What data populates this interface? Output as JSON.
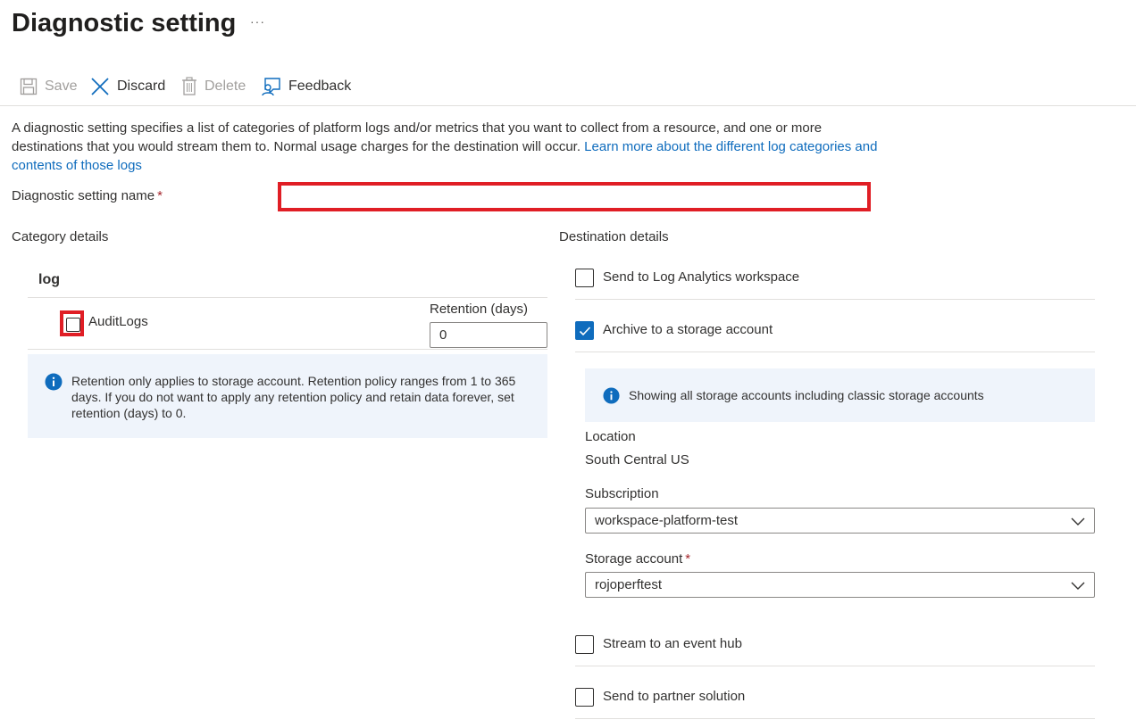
{
  "header": {
    "title": "Diagnostic setting",
    "more": "···"
  },
  "toolbar": {
    "save": "Save",
    "discard": "Discard",
    "delete": "Delete",
    "feedback": "Feedback"
  },
  "description": {
    "text": "A diagnostic setting specifies a list of categories of platform logs and/or metrics that you want to collect from a resource, and one or more destinations that you would stream them to. Normal usage charges for the destination will occur. ",
    "link": "Learn more about the different log categories and contents of those logs"
  },
  "name_field": {
    "label": "Diagnostic setting name",
    "required": "*",
    "value": ""
  },
  "category": {
    "title": "Category details",
    "group": "log",
    "items": [
      {
        "label": "AuditLogs",
        "checked": false
      }
    ],
    "retention_label": "Retention (days)",
    "retention_value": "0",
    "info": "Retention only applies to storage account. Retention policy ranges from 1 to 365 days. If you do not want to apply any retention policy and retain data forever, set retention (days) to 0."
  },
  "destination": {
    "title": "Destination details",
    "log_analytics": {
      "label": "Send to Log Analytics workspace",
      "checked": false
    },
    "storage": {
      "label": "Archive to a storage account",
      "checked": true
    },
    "storage_info": "Showing all storage accounts including classic storage accounts",
    "location_label": "Location",
    "location_value": "South Central US",
    "subscription_label": "Subscription",
    "subscription_value": "workspace-platform-test",
    "storage_account_label": "Storage account",
    "storage_account_required": "*",
    "storage_account_value": "rojoperftest",
    "event_hub": {
      "label": "Stream to an event hub",
      "checked": false
    },
    "partner": {
      "label": "Send to partner solution",
      "checked": false
    }
  },
  "colors": {
    "accent": "#0f6cbd",
    "highlight": "#e01e25",
    "info_bg": "#eff4fb",
    "required": "#a4262c"
  }
}
